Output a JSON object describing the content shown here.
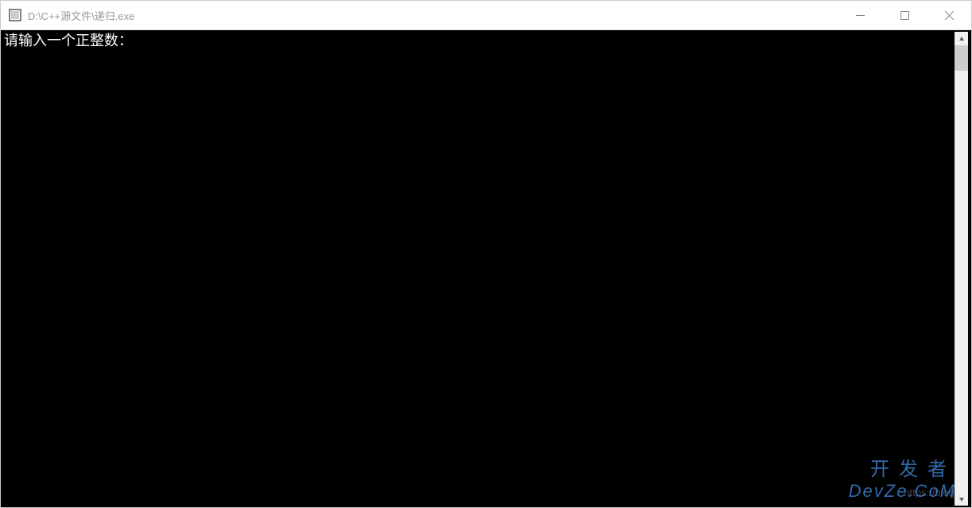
{
  "window": {
    "title": "D:\\C++源文件\\递归.exe"
  },
  "console": {
    "prompt": "请输入一个正整数："
  },
  "watermark": {
    "line1": "开发者",
    "line2": "DevZe.CoM",
    "url": "https://blog"
  }
}
